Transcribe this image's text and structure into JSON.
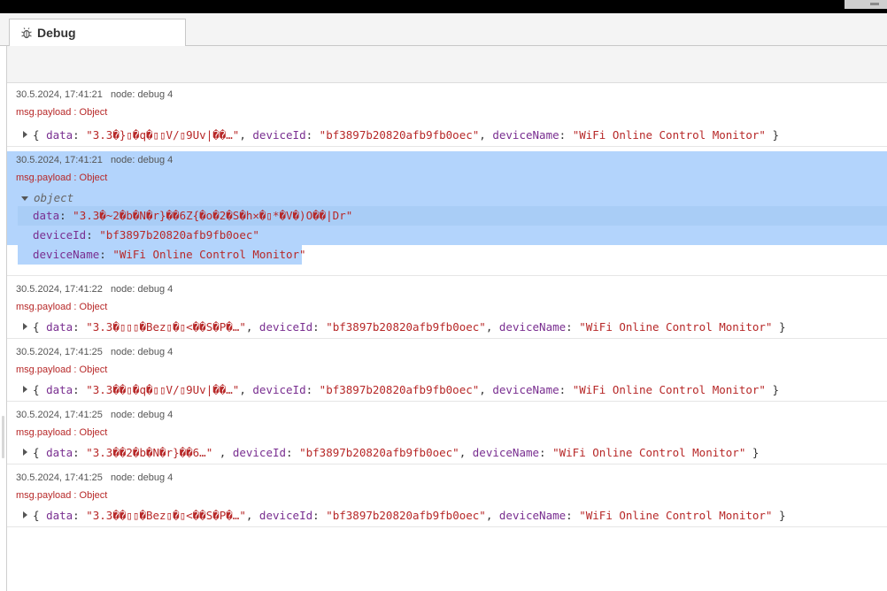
{
  "tab": {
    "label": "Debug",
    "icon": "bug-icon"
  },
  "messages": [
    {
      "timestamp": "30.5.2024, 17:41:21",
      "node": "node: debug 4",
      "topic": "msg.payload : Object",
      "expanded": false,
      "data_key": "data",
      "data_value": "\"3.3�}▯�q�▯▯V/▯9Uv|��…\"",
      "deviceId_key": "deviceId",
      "deviceId_value": "\"bf3897b20820afb9fb0oec\"",
      "deviceName_key": "deviceName",
      "deviceName_value": "\"WiFi Online Control Monitor\""
    },
    {
      "timestamp": "30.5.2024, 17:41:21",
      "node": "node: debug 4",
      "topic": "msg.payload : Object",
      "expanded": true,
      "tree_label": "object",
      "data_key": "data",
      "data_value": "\"3.3�~2�b�N�r}��6Z{�o�2�S�h✕�▯*�V�)O��|Dr\"",
      "deviceId_key": "deviceId",
      "deviceId_value": "\"bf3897b20820afb9fb0oec\"",
      "deviceName_key": "deviceName",
      "deviceName_value": "\"WiFi Online Control Monitor\""
    },
    {
      "timestamp": "30.5.2024, 17:41:22",
      "node": "node: debug 4",
      "topic": "msg.payload : Object",
      "expanded": false,
      "data_key": "data",
      "data_value": "\"3.3�▯▯▯�Bez▯�▯<��S�P�…\"",
      "deviceId_key": "deviceId",
      "deviceId_value": "\"bf3897b20820afb9fb0oec\"",
      "deviceName_key": "deviceName",
      "deviceName_value": "\"WiFi Online Control Monitor\""
    },
    {
      "timestamp": "30.5.2024, 17:41:25",
      "node": "node: debug 4",
      "topic": "msg.payload : Object",
      "expanded": false,
      "data_key": "data",
      "data_value": "\"3.3��▯�q�▯▯V/▯9Uv|��…\"",
      "deviceId_key": "deviceId",
      "deviceId_value": "\"bf3897b20820afb9fb0oec\"",
      "deviceName_key": "deviceName",
      "deviceName_value": "\"WiFi Online Control Monitor\""
    },
    {
      "timestamp": "30.5.2024, 17:41:25",
      "node": "node: debug 4",
      "topic": "msg.payload : Object",
      "expanded": false,
      "data_key": "data",
      "data_value": "\"3.3��2�b�N�r}��6…\" ",
      "deviceId_key": "deviceId",
      "deviceId_value": "\"bf3897b20820afb9fb0oec\"",
      "deviceName_key": "deviceName",
      "deviceName_value": "\"WiFi Online Control Monitor\""
    },
    {
      "timestamp": "30.5.2024, 17:41:25",
      "node": "node: debug 4",
      "topic": "msg.payload : Object",
      "expanded": false,
      "data_key": "data",
      "data_value": "\"3.3��▯▯�Bez▯�▯<��S�P�…\"",
      "deviceId_key": "deviceId",
      "deviceId_value": "\"bf3897b20820afb9fb0oec\"",
      "deviceName_key": "deviceName",
      "deviceName_value": "\"WiFi Online Control Monitor\""
    }
  ],
  "colors": {
    "key": "#792e90",
    "string": "#b72828",
    "selection": "#b3d4fc",
    "topic": "#b72828"
  }
}
